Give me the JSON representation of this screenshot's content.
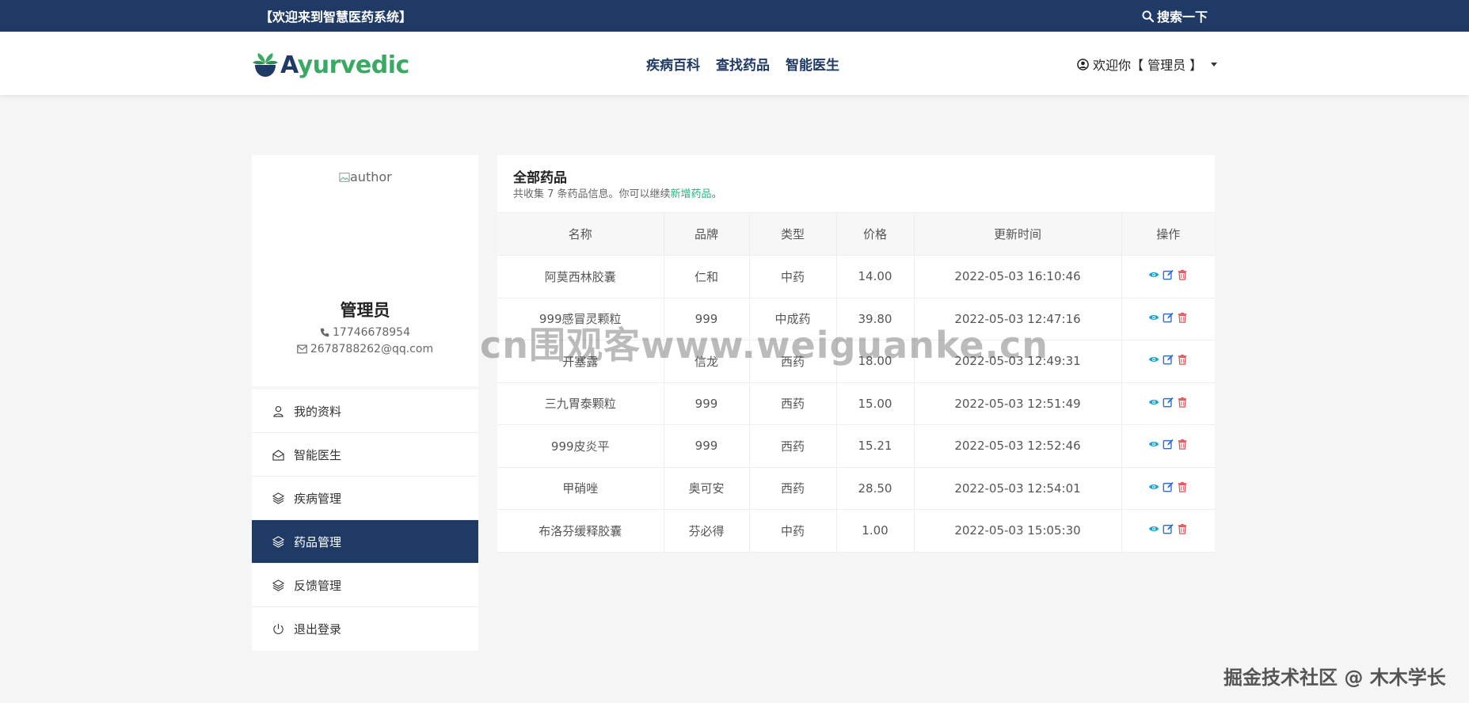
{
  "topbar": {
    "welcome": "【欢迎来到智慧医药系统】",
    "search_label": "搜索一下"
  },
  "navbar": {
    "logo_prefix": "A",
    "logo_rest": "yurvedic",
    "links": [
      "疾病百科",
      "查找药品",
      "智能医生"
    ],
    "user_label": "欢迎你【 管理员 】"
  },
  "profile": {
    "avatar_alt": "author",
    "name": "管理员",
    "phone": "17746678954",
    "email": "2678788262@qq.com"
  },
  "side_menu": [
    {
      "label": "我的资料",
      "icon": "user-icon"
    },
    {
      "label": "智能医生",
      "icon": "envelope-open-icon"
    },
    {
      "label": "疾病管理",
      "icon": "layers-icon"
    },
    {
      "label": "药品管理",
      "icon": "layers-icon",
      "active": true
    },
    {
      "label": "反馈管理",
      "icon": "layers-icon"
    },
    {
      "label": "退出登录",
      "icon": "power-icon"
    }
  ],
  "main": {
    "title": "全部药品",
    "subtitle_prefix": "共收集 7 条药品信息。你可以继续",
    "subtitle_link": "新增药品",
    "subtitle_suffix": "。",
    "columns": [
      "名称",
      "品牌",
      "类型",
      "价格",
      "更新时间",
      "操作"
    ],
    "rows": [
      [
        "阿莫西林胶囊",
        "仁和",
        "中药",
        "14.00",
        "2022-05-03 16:10:46"
      ],
      [
        "999感冒灵颗粒",
        "999",
        "中成药",
        "39.80",
        "2022-05-03 12:47:16"
      ],
      [
        "开塞露",
        "信龙",
        "西药",
        "18.00",
        "2022-05-03 12:49:31"
      ],
      [
        "三九胃泰颗粒",
        "999",
        "西药",
        "15.00",
        "2022-05-03 12:51:49"
      ],
      [
        "999皮炎平",
        "999",
        "西药",
        "15.21",
        "2022-05-03 12:52:46"
      ],
      [
        "甲硝唑",
        "奥可安",
        "西药",
        "28.50",
        "2022-05-03 12:54:01"
      ],
      [
        "布洛芬缓释胶囊",
        "芬必得",
        "中药",
        "1.00",
        "2022-05-03 15:05:30"
      ]
    ]
  },
  "overlays": {
    "watermark": "cn围观客www.weiguanke.cn",
    "footer": "掘金技术社区 @ 木木学长"
  },
  "colors": {
    "primary": "#1f3a64",
    "green": "#3aa963",
    "link": "#2bb07a",
    "view": "#17a2d8",
    "edit": "#2d6fd6",
    "delete": "#e0505a"
  }
}
